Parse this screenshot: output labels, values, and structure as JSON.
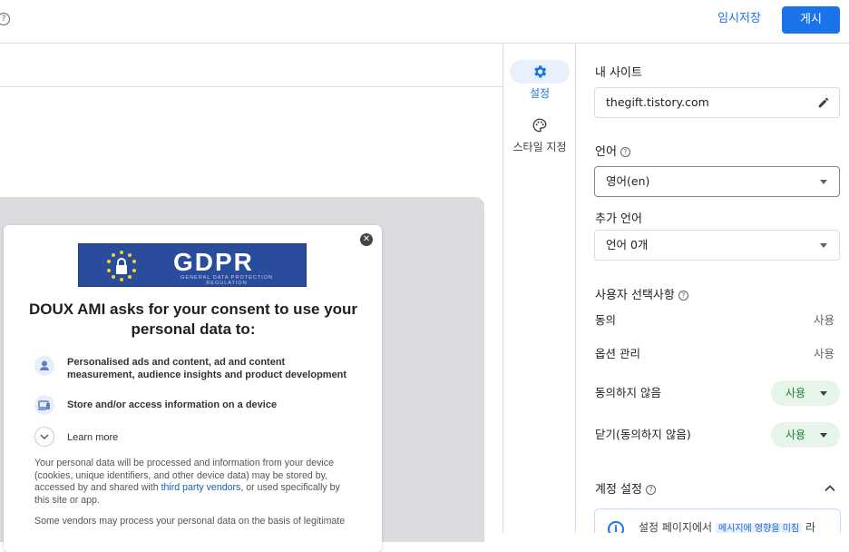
{
  "topbar": {
    "help_icon": "help-circle-icon",
    "save_draft": "임시저장",
    "publish": "게시"
  },
  "consent": {
    "gdpr_logo_text": "GDPR",
    "gdpr_logo_sub": "GENERAL DATA PROTECTION REGULATION",
    "title": "DOUX AMI asks for your consent to use your personal data to:",
    "purposes": [
      {
        "icon": "person-icon",
        "text": "Personalised ads and content, ad and content measurement, audience insights and product development"
      },
      {
        "icon": "devices-icon",
        "text": "Store and/or access information on a device"
      }
    ],
    "learn_more": "Learn more",
    "paragraph1_before": "Your personal data will be processed and information from your device (cookies, unique identifiers, and other device data) may be stored by, accessed by and shared with ",
    "paragraph1_link": "third party vendors",
    "paragraph1_after": ", or used specifically by this site or app.",
    "paragraph2": "Some vendors may process your personal data on the basis of legitimate"
  },
  "rail": {
    "settings": "설정",
    "style": "스타일 지정"
  },
  "settings": {
    "my_site_label": "내 사이트",
    "my_site_value": "thegift.tistory.com",
    "language_label": "언어",
    "language_value": "영어(en)",
    "extra_language_label": "추가 언어",
    "extra_language_value": "언어 0개",
    "user_choices_label": "사용자 선택사항",
    "prefs": [
      {
        "label": "동의",
        "value": "사용",
        "style": "text"
      },
      {
        "label": "옵션 관리",
        "value": "사용",
        "style": "text"
      },
      {
        "label": "동의하지 않음",
        "value": "사용",
        "style": "chip"
      },
      {
        "label": "닫기(동의하지 않음)",
        "value": "사용",
        "style": "chip"
      }
    ],
    "account_label": "계정 설정",
    "notice_before": "설정 페이지에서",
    "notice_chip": "메시지에 영향을 미침",
    "notice_after": "라"
  },
  "colors": {
    "accent": "#1a73e8",
    "chip_bg": "#e6f4ea",
    "chip_text": "#188038",
    "gdpr_blue": "#2a4c9c"
  }
}
